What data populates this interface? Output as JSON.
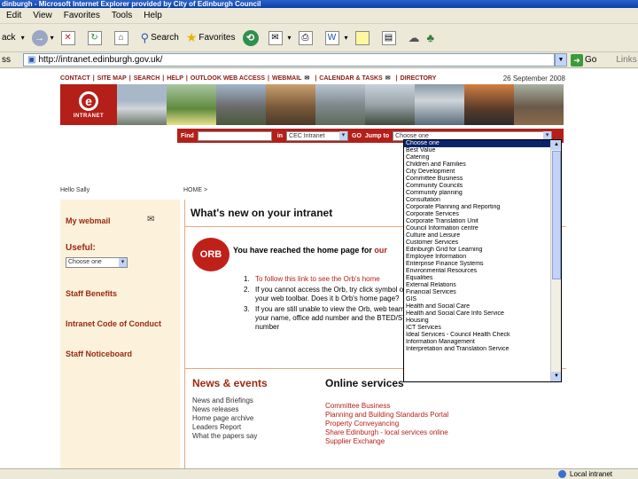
{
  "window": {
    "title": "dinburgh - Microsoft Internet Explorer provided by City of Edinburgh Council"
  },
  "menubar": {
    "items": [
      "Edit",
      "View",
      "Favorites",
      "Tools",
      "Help"
    ]
  },
  "toolbar": {
    "back_label": "ack",
    "search_label": "Search",
    "favorites_label": "Favorites"
  },
  "address": {
    "label": "ss",
    "url": "http://intranet.edinburgh.gov.uk/",
    "go_label": "Go",
    "links_label": "Links"
  },
  "site": {
    "nav": [
      "CONTACT",
      "SITE MAP",
      "SEARCH",
      "HELP",
      "OUTLOOK WEB ACCESS",
      "WEBMAIL",
      "CALENDAR & TASKS",
      "DIRECTORY"
    ],
    "date": "26 September 2008",
    "logo_text": "INTRANET",
    "logo_letter": "e",
    "search": {
      "find_label": "Find",
      "in_label": "in",
      "scope_value": "CEC Intranet",
      "go_label": "GO",
      "jump_label": "Jump to",
      "jump_value": "Choose one"
    },
    "greeting": "Hello Sally",
    "breadcrumb": "HOME >",
    "sidebar": {
      "webmail": "My webmail",
      "useful_heading": "Useful:",
      "useful_select": "Choose one",
      "links": [
        "Staff Benefits",
        "Intranet Code of Conduct",
        "Staff Noticeboard"
      ]
    },
    "main": {
      "title": "What's new on your intranet",
      "orb_logo": "ORB",
      "orb_text_prefix": "You have reached the home page for ",
      "orb_text_suffix": "our",
      "steps": [
        {
          "num": "1.",
          "text": "To follow this link to see the Orb's home"
        },
        {
          "num": "2.",
          "text": "If you cannot access the Orb, try click symbol on your web toolbar. Does it b Orb's home page?"
        },
        {
          "num": "3.",
          "text": "If you are still unable to view the Orb, web team with your name, office add number and the BTED/SYTA number"
        }
      ],
      "news_title": "News & events",
      "news_items": [
        "News and Briefings",
        "News releases",
        "Home page archive",
        "Leaders Report",
        "What the papers say"
      ],
      "online_title": "Online services",
      "online_items": [
        "Committee Business",
        "Planning and Building Standards Portal",
        "Property Conveyancing",
        "Share Edinburgh - local services online",
        "Supplier Exchange"
      ]
    },
    "dropdown": {
      "options": [
        "Choose one",
        "Best Value",
        "Catering",
        "Children and Families",
        "City Development",
        "Committee Business",
        "Community Councils",
        "Community planning",
        "Consultation",
        "Corporate Planning and Reporting",
        "Corporate Services",
        "Corporate Translation Unit",
        "Council Information centre",
        "Culture and Leisure",
        "Customer Services",
        "Edinburgh Grid for Learning",
        "Employee Information",
        "Enterprise Finance Systems",
        "Environmental Resources",
        "Equalities",
        "External Relations",
        "Financial Services",
        "GIS",
        "Health and Social Care",
        "Health and Social Care Info Service",
        "Housing",
        "ICT Services",
        "Ideal Services - Council Health Check",
        "Information Management",
        "Interpretation and Translation Service"
      ]
    }
  },
  "status": {
    "zone": "Local intranet"
  }
}
